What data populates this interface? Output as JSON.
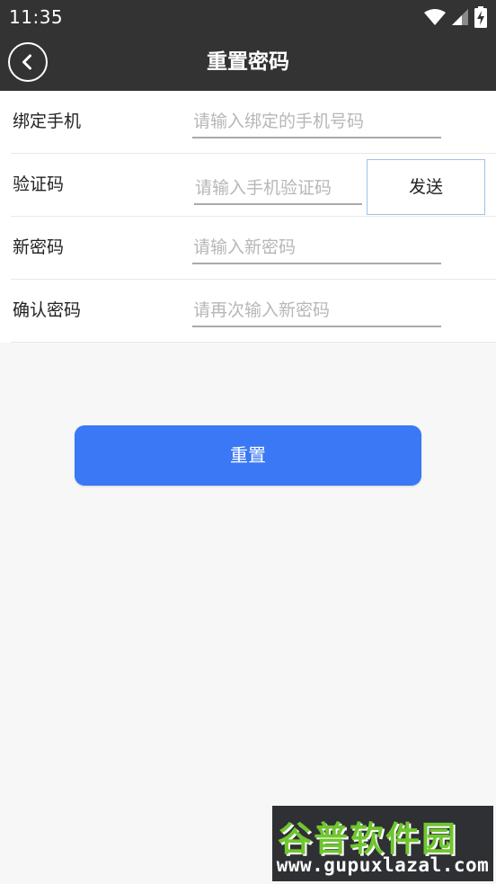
{
  "status_bar": {
    "time": "11:35",
    "icons": [
      "wifi-icon",
      "signal-icon",
      "battery-charging-icon"
    ]
  },
  "app_bar": {
    "back_icon": "back-arrow-icon",
    "title": "重置密码",
    "background_color": "#333333"
  },
  "form": {
    "phone": {
      "label": "绑定手机",
      "placeholder": "请输入绑定的手机号码",
      "value": ""
    },
    "code": {
      "label": "验证码",
      "placeholder": "请输入手机验证码",
      "value": "",
      "send_label": "发送"
    },
    "new_password": {
      "label": "新密码",
      "placeholder": "请输入新密码",
      "value": ""
    },
    "confirm_password": {
      "label": "确认密码",
      "placeholder": "请再次输入新密码",
      "value": ""
    }
  },
  "reset_button": {
    "label": "重置",
    "color": "#3a78f5"
  },
  "watermark": {
    "name": "谷普软件园",
    "url": "www.gupuxlazal.com"
  }
}
